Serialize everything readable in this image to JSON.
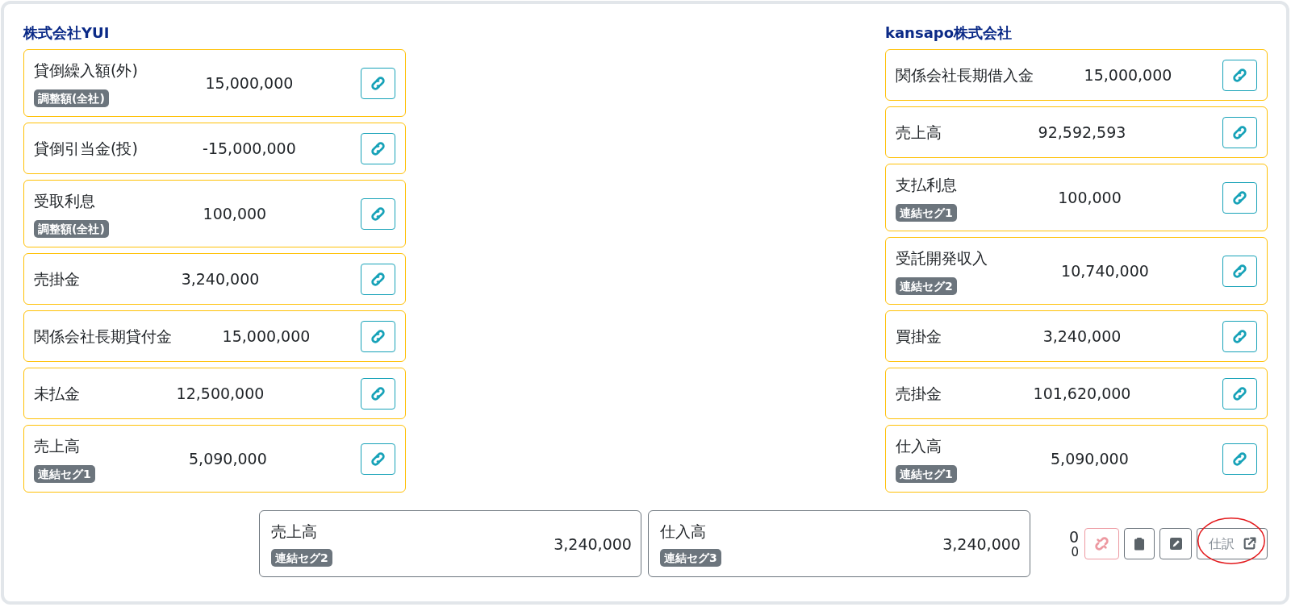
{
  "companies": [
    {
      "name": "株式会社YUI",
      "accounts": [
        {
          "label": "貸倒繰入額(外)",
          "tag": "調整額(全社)",
          "amount": "15,000,000"
        },
        {
          "label": "貸倒引当金(投)",
          "amount": "-15,000,000"
        },
        {
          "label": "受取利息",
          "tag": "調整額(全社)",
          "amount": "100,000"
        },
        {
          "label": "売掛金",
          "amount": "3,240,000"
        },
        {
          "label": "関係会社長期貸付金",
          "amount": "15,000,000"
        },
        {
          "label": "未払金",
          "amount": "12,500,000"
        },
        {
          "label": "売上高",
          "tag": "連結セグ1",
          "amount": "5,090,000"
        }
      ]
    },
    {
      "name": "kansapo株式会社",
      "accounts": [
        {
          "label": "関係会社長期借入金",
          "amount": "15,000,000"
        },
        {
          "label": "売上高",
          "amount": "92,592,593"
        },
        {
          "label": "支払利息",
          "tag": "連結セグ1",
          "amount": "100,000"
        },
        {
          "label": "受託開発収入",
          "tag": "連結セグ2",
          "amount": "10,740,000"
        },
        {
          "label": "買掛金",
          "amount": "3,240,000"
        },
        {
          "label": "売掛金",
          "amount": "101,620,000"
        },
        {
          "label": "仕入高",
          "tag": "連結セグ1",
          "amount": "5,090,000"
        }
      ]
    }
  ],
  "matched": {
    "entries": [
      {
        "label": "売上高",
        "tag": "連結セグ2",
        "amount": "3,240,000"
      },
      {
        "label": "仕入高",
        "tag": "連結セグ3",
        "amount": "3,240,000"
      }
    ],
    "counts": [
      {
        "kind": "major",
        "text": "0"
      },
      {
        "kind": "minor",
        "text": "0"
      }
    ],
    "actions": [
      {
        "kind": "unlink",
        "disabled": true,
        "highlighted": false
      },
      {
        "kind": "clipboard",
        "disabled": false,
        "highlighted": false
      },
      {
        "kind": "edit",
        "disabled": false,
        "highlighted": false
      },
      {
        "kind": "journal",
        "label": "仕訳",
        "disabled": false,
        "highlighted": true
      }
    ]
  }
}
